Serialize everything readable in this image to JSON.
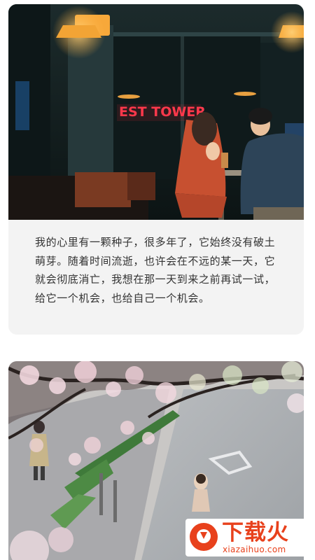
{
  "post1": {
    "photo_sign": "EST TOWER",
    "caption": "我的心里有一颗种子，很多年了，它始终没有破土萌芽。随着时间流逝，也许会在不远的某一天，它就会彻底消亡，我想在那一天到来之前再试一试，给它一个机会，也给自己一个机会。"
  },
  "watermark": {
    "title": "下载火",
    "domain": "xiazaihuo.com",
    "color": "#e8411c"
  }
}
